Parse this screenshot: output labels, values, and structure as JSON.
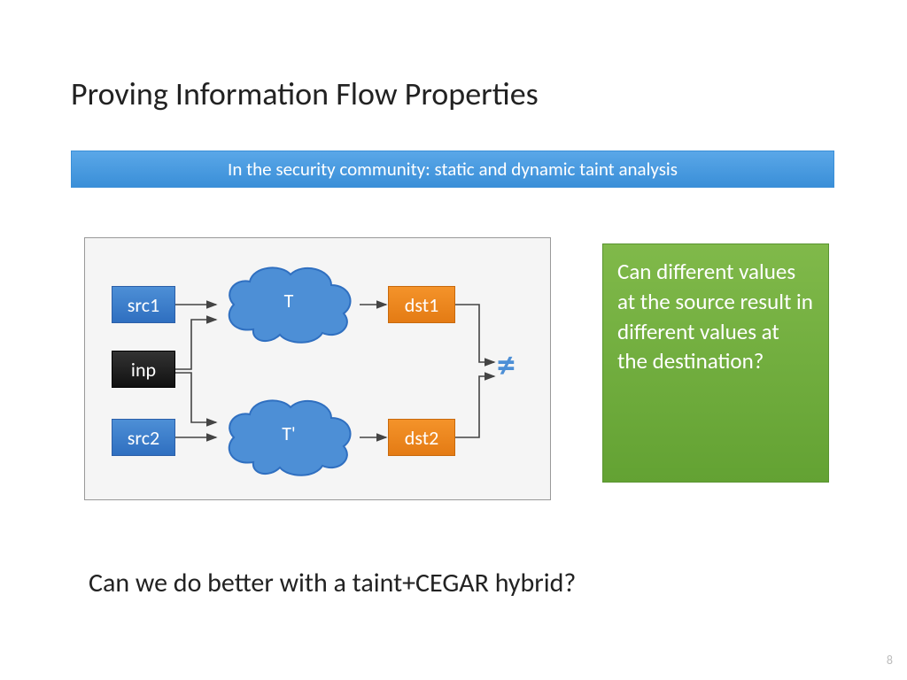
{
  "title": "Proving Information Flow Properties",
  "banner": "In the security community: static and dynamic taint analysis",
  "diagram": {
    "src1": "src1",
    "src2": "src2",
    "inp": "inp",
    "cloud_top": "T",
    "cloud_bottom": "T'",
    "dst1": "dst1",
    "dst2": "dst2",
    "neq_symbol": "≠"
  },
  "callout": "Can different values at the source result in different values at the destination?",
  "bottom_question": "Can we do better with a taint+CEGAR hybrid?",
  "page_number": "8"
}
